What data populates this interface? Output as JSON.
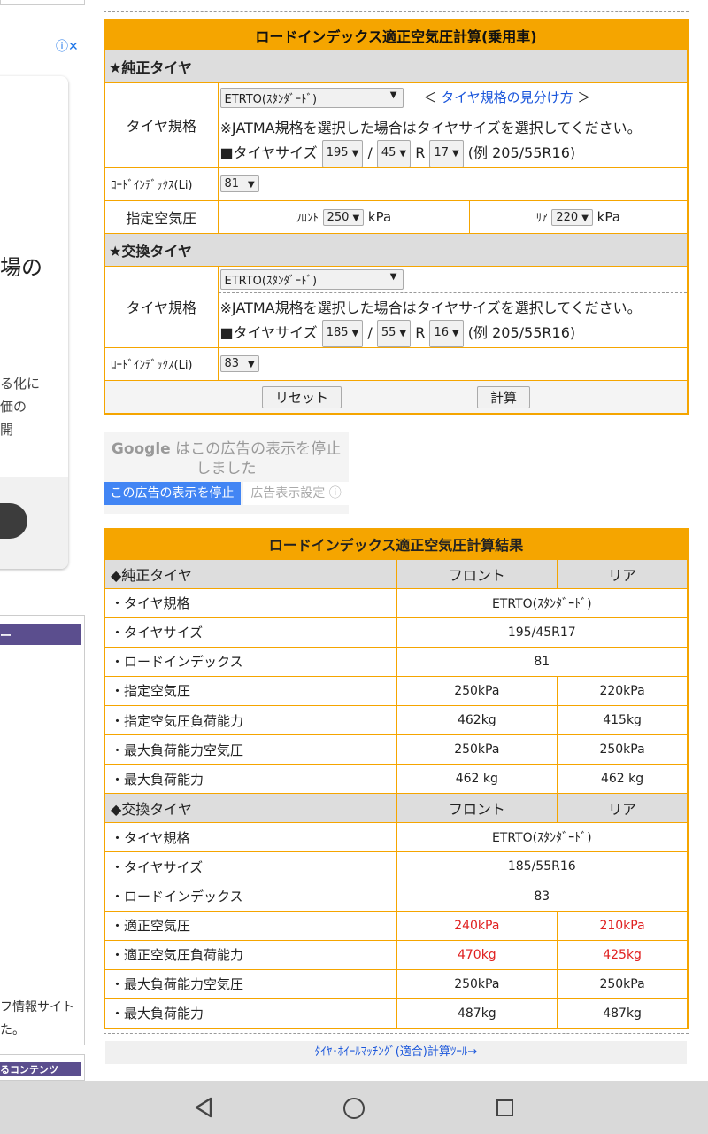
{
  "left_ad": {
    "info_icon": "ⓘ✕",
    "headline": "場の",
    "body_lines": [
      "る化に",
      "価の",
      "開"
    ],
    "panel_header": "ー",
    "footer_lines": [
      "フ情報サイト",
      "た。"
    ],
    "panel2_header": "るコンテンツ"
  },
  "form": {
    "title": "ロードインデックス適正空気圧計算(乗用車)",
    "oem_header": "★純正タイヤ",
    "replace_header": "★交換タイヤ",
    "tire_spec_label": "タイヤ規格",
    "li_label": "ﾛｰﾄﾞｲﾝﾃﾞｯｸｽ(Li)",
    "pressure_label": "指定空気圧",
    "spec_value": "ETRTO(ｽﾀﾝﾀﾞｰﾄﾞ)",
    "link_open": "＜",
    "link_text": "タイヤ規格の見分け方",
    "link_close": "＞",
    "jatma_note": "※JATMA規格を選択した場合はタイヤサイズを選択してください。",
    "size_label": "■タイヤサイズ",
    "slash": "/",
    "r_label": "R",
    "example": "(例 205/55R16)",
    "oem_width": "195",
    "oem_aspect": "45",
    "oem_rim": "17",
    "oem_li": "81",
    "front_label": "ﾌﾛﾝﾄ",
    "rear_label": "ﾘｱ",
    "front_pressure": "250",
    "rear_pressure": "220",
    "kpa": "kPa",
    "rep_width": "185",
    "rep_aspect": "55",
    "rep_rim": "16",
    "rep_li": "83",
    "reset_button": "リセット",
    "calc_button": "計算"
  },
  "google_ad": {
    "logo": "Google",
    "message_1": "はこの広告の表示を停止",
    "message_2": "しました",
    "stop_button": "この広告の表示を停止",
    "settings_button": "広告表示設定 ⓘ"
  },
  "results": {
    "title": "ロードインデックス適正空気圧計算結果",
    "oem_header": "◆純正タイヤ",
    "replace_header": "◆交換タイヤ",
    "front": "フロント",
    "rear": "リア",
    "oem_rows": [
      {
        "label": "・タイヤ規格",
        "value": "ETRTO(ｽﾀﾝﾀﾞｰﾄﾞ)"
      },
      {
        "label": "・タイヤサイズ",
        "value": "195/45R17"
      },
      {
        "label": "・ロードインデックス",
        "value": "81"
      },
      {
        "label": "・指定空気圧",
        "front": "250kPa",
        "rear": "220kPa"
      },
      {
        "label": "・指定空気圧負荷能力",
        "front": "462kg",
        "rear": "415kg"
      },
      {
        "label": "・最大負荷能力空気圧",
        "front": "250kPa",
        "rear": "250kPa"
      },
      {
        "label": "・最大負荷能力",
        "front": "462 kg",
        "rear": "462 kg"
      }
    ],
    "rep_rows": [
      {
        "label": "・タイヤ規格",
        "value": "ETRTO(ｽﾀﾝﾀﾞｰﾄﾞ)"
      },
      {
        "label": "・タイヤサイズ",
        "value": "185/55R16"
      },
      {
        "label": "・ロードインデックス",
        "value": "83"
      },
      {
        "label": "・適正空気圧",
        "front": "240kPa",
        "rear": "210kPa"
      },
      {
        "label": "・適正空気圧負荷能力",
        "front": "470kg",
        "rear": "425kg"
      },
      {
        "label": "・最大負荷能力空気圧",
        "front": "250kPa",
        "rear": "250kPa"
      },
      {
        "label": "・最大負荷能力",
        "front": "487kg",
        "rear": "487kg"
      }
    ],
    "highlight_color": "#e02020"
  },
  "footer_link": "ﾀｲﾔ･ﾎｲｰﾙﾏｯﾁﾝｸﾞ(適合)計算ﾂｰﾙ→",
  "navbar": {
    "back": "back-icon",
    "home": "home-icon",
    "recent": "recent-apps-icon"
  }
}
